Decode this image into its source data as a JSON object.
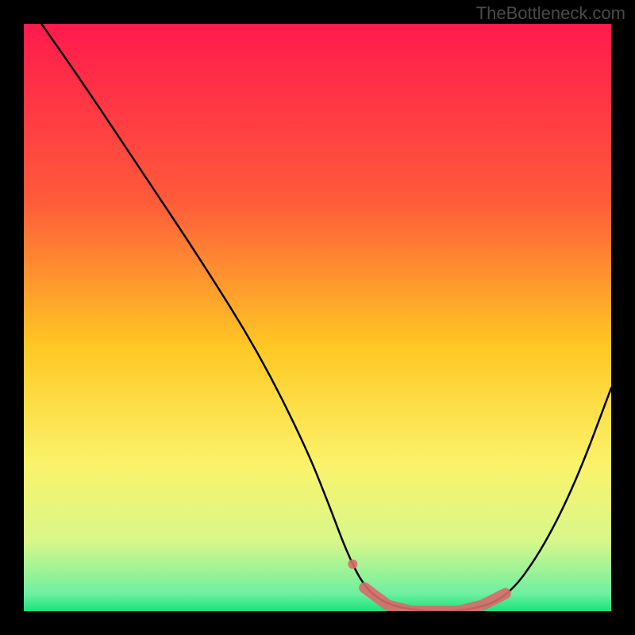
{
  "watermark": "TheBottleneck.com",
  "chart_data": {
    "type": "line",
    "title": "",
    "xlabel": "",
    "ylabel": "",
    "xlim": [
      0,
      100
    ],
    "ylim": [
      0,
      100
    ],
    "series": [
      {
        "name": "curve",
        "x": [
          3,
          10,
          20,
          30,
          40,
          48,
          52,
          55,
          58,
          62,
          68,
          75,
          82,
          88,
          94,
          100
        ],
        "y": [
          100,
          90,
          75,
          60,
          44,
          28,
          18,
          10,
          4,
          1,
          0,
          0,
          2,
          10,
          22,
          38
        ]
      },
      {
        "name": "highlight",
        "x": [
          58,
          62,
          66,
          70,
          74,
          78,
          82
        ],
        "y": [
          4,
          1,
          0,
          0,
          0,
          1,
          3
        ]
      }
    ],
    "gradient_stops": [
      {
        "pos": 0.0,
        "color": "#ff1a4d"
      },
      {
        "pos": 0.3,
        "color": "#ff5a3a"
      },
      {
        "pos": 0.55,
        "color": "#ffc824"
      },
      {
        "pos": 0.75,
        "color": "#faf36a"
      },
      {
        "pos": 0.88,
        "color": "#d9f78a"
      },
      {
        "pos": 0.97,
        "color": "#6ef0a0"
      },
      {
        "pos": 1.0,
        "color": "#19e37a"
      }
    ]
  }
}
